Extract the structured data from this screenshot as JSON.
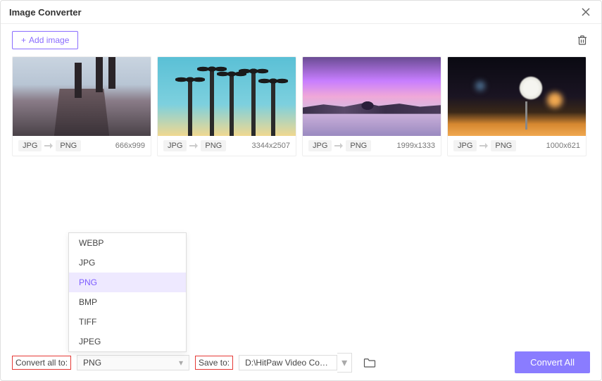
{
  "window": {
    "title": "Image Converter"
  },
  "toolbar": {
    "add_image_label": "Add image"
  },
  "images": [
    {
      "from": "JPG",
      "to": "PNG",
      "dims": "666x999"
    },
    {
      "from": "JPG",
      "to": "PNG",
      "dims": "3344x2507"
    },
    {
      "from": "JPG",
      "to": "PNG",
      "dims": "1999x1333"
    },
    {
      "from": "JPG",
      "to": "PNG",
      "dims": "1000x621"
    }
  ],
  "format_dropdown": {
    "options": [
      "WEBP",
      "JPG",
      "PNG",
      "BMP",
      "TIFF",
      "JPEG"
    ],
    "selected": "PNG"
  },
  "footer": {
    "convert_all_to_label": "Convert all to:",
    "format_selected": "PNG",
    "save_to_label": "Save to:",
    "save_path": "D:\\HitPaw Video Conve...",
    "convert_button": "Convert All"
  }
}
